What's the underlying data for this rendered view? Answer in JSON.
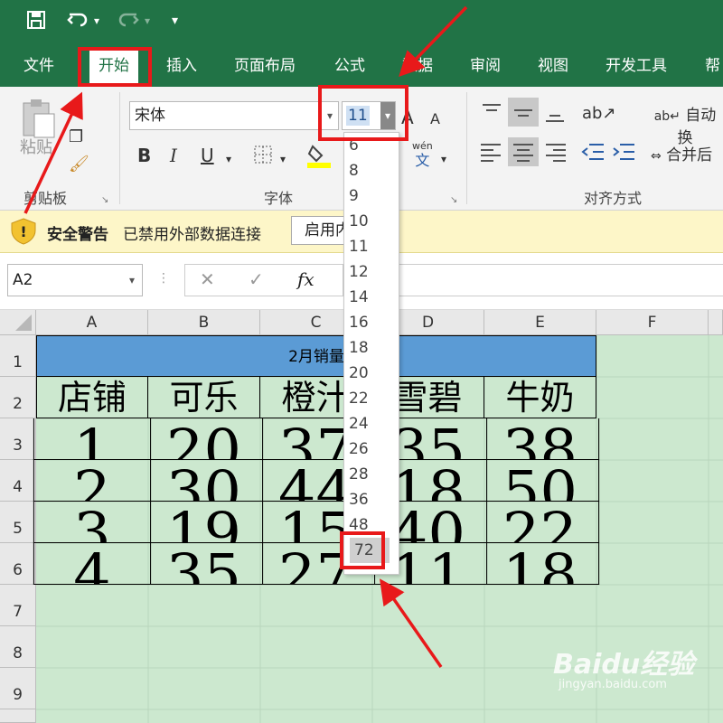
{
  "quick_access": {
    "save_icon": "save-icon",
    "undo_icon": "undo-icon",
    "redo_icon": "redo-icon",
    "customize_icon": "customize-icon"
  },
  "tabs": [
    "文件",
    "开始",
    "插入",
    "页面布局",
    "公式",
    "数据",
    "审阅",
    "视图",
    "开发工具",
    "帮"
  ],
  "ribbon": {
    "clipboard": {
      "paste_label": "粘贴",
      "group_label": "剪贴板"
    },
    "font": {
      "font_name": "宋体",
      "font_size": "11",
      "bold": "B",
      "italic": "I",
      "underline": "U",
      "grow": "A",
      "shrink": "A",
      "phonetic_top": "wén",
      "phonetic_bottom": "文",
      "group_label": "字体"
    },
    "alignment": {
      "wrap_label": "自动换",
      "merge_label": "合并后",
      "group_label": "对齐方式"
    }
  },
  "security_bar": {
    "title": "安全警告",
    "message": "已禁用外部数据连接",
    "button": "启用内"
  },
  "formula_bar": {
    "name_box": "A2",
    "cancel": "✕",
    "confirm": "✓",
    "fx": "fx"
  },
  "columns": [
    "A",
    "B",
    "C",
    "D",
    "E",
    "F"
  ],
  "rows": [
    "1",
    "2",
    "3",
    "4",
    "5",
    "6",
    "7",
    "8",
    "9"
  ],
  "sheet": {
    "title": "2月销量",
    "headers": [
      "店铺",
      "可乐",
      "橙汁",
      "雪碧",
      "牛奶"
    ],
    "data": [
      [
        "1",
        "20",
        "37",
        "35",
        "38"
      ],
      [
        "2",
        "30",
        "44",
        "18",
        "50"
      ],
      [
        "3",
        "19",
        "15",
        "40",
        "22"
      ],
      [
        "4",
        "35",
        "27",
        "11",
        "18"
      ]
    ]
  },
  "font_size_dropdown": [
    "6",
    "8",
    "9",
    "10",
    "11",
    "12",
    "14",
    "16",
    "18",
    "20",
    "22",
    "24",
    "26",
    "28",
    "36",
    "48",
    "72"
  ],
  "highlight_color": "#e8191a",
  "watermark": {
    "brand": "Baidu经验",
    "url": "jingyan.baidu.com"
  }
}
